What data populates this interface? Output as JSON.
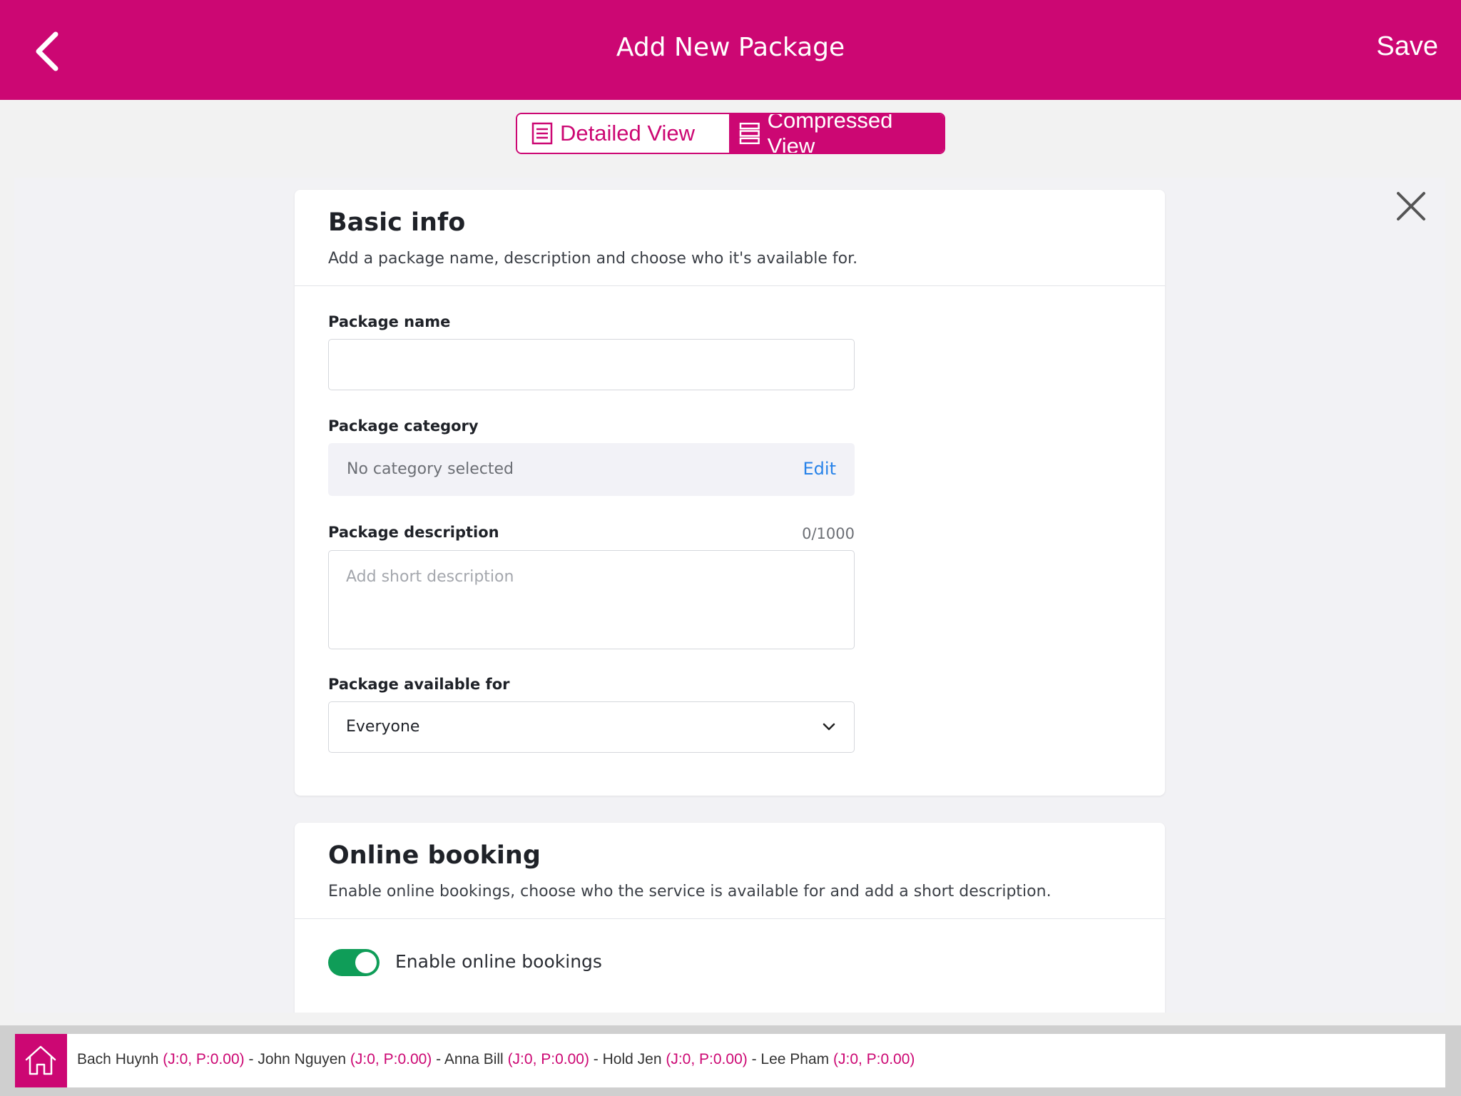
{
  "header": {
    "title": "Add New Package",
    "save_label": "Save"
  },
  "view_toggle": {
    "detailed_label": "Detailed View",
    "compressed_label": "Compressed View",
    "active": "Compressed View"
  },
  "basic_info": {
    "title": "Basic info",
    "subtitle": "Add a package name, description and choose who it's available for.",
    "package_name": {
      "label": "Package name",
      "value": ""
    },
    "package_category": {
      "label": "Package category",
      "value": "No category selected",
      "edit_label": "Edit"
    },
    "package_description": {
      "label": "Package description",
      "counter": "0/1000",
      "placeholder": "Add short description",
      "value": ""
    },
    "available_for": {
      "label": "Package available for",
      "selected": "Everyone"
    }
  },
  "online_booking": {
    "title": "Online booking",
    "subtitle": "Enable online bookings, choose who the service is available for and add a short description.",
    "toggle_label": "Enable online bookings",
    "enabled": true
  },
  "staff": [
    {
      "name": "Bach Huynh",
      "stats": "(J:0, P:0.00)",
      "sep": " - "
    },
    {
      "name": "John Nguyen",
      "stats": "(J:0, P:0.00)",
      "sep": " - "
    },
    {
      "name": "Anna Bill",
      "stats": "(J:0, P:0.00)",
      "sep": " - "
    },
    {
      "name": "Hold Jen",
      "stats": "(J:0, P:0.00)",
      "sep": " - "
    },
    {
      "name": "Lee Pham",
      "stats": "(J:0, P:0.00)",
      "sep": ""
    }
  ],
  "colors": {
    "brand": "#cc0773",
    "link": "#2883e9",
    "toggle_on": "#0f9d58"
  }
}
